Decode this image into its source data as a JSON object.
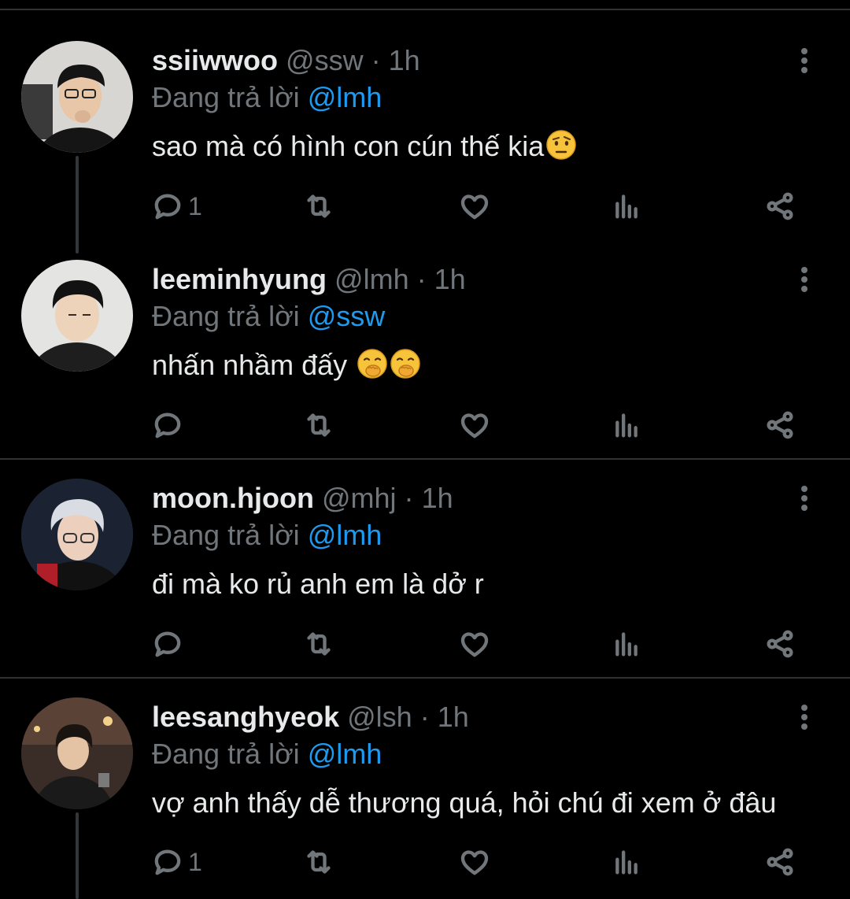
{
  "reply_prefix": "Đang trả lời",
  "icons": {
    "more": "more-vertical-icon",
    "reply": "reply-bubble-icon",
    "retweet": "retweet-icon",
    "like": "heart-icon",
    "views": "bar-chart-icon",
    "share": "share-icon"
  },
  "colors": {
    "background": "#000000",
    "text": "#e7e9ea",
    "muted": "#71767b",
    "mention": "#1d9bf0",
    "divider": "#2f3336"
  },
  "tweets": [
    {
      "name": "ssiiwwoo",
      "handle": "@ssw",
      "separator": "·",
      "time": "1h",
      "replying_to": "@lmh",
      "text": "sao mà có hình con cún thế kia",
      "emojis": [
        "face-with-raised-eyebrow"
      ],
      "reply_count": "1"
    },
    {
      "name": "leeminhyung",
      "handle": "@lmh",
      "separator": "·",
      "time": "1h",
      "replying_to": "@ssw",
      "text": "nhấn nhầm đấy ",
      "emojis": [
        "face-with-hand-over-mouth",
        "face-with-hand-over-mouth"
      ],
      "reply_count": ""
    },
    {
      "name": "moon.hjoon",
      "handle": "@mhj",
      "separator": "·",
      "time": "1h",
      "replying_to": "@lmh",
      "text": "đi mà ko rủ anh em là dở r",
      "emojis": [],
      "reply_count": ""
    },
    {
      "name": "leesanghyeok",
      "handle": "@lsh",
      "separator": "·",
      "time": "1h",
      "replying_to": "@lmh",
      "text": "vợ anh thấy dễ thương quá, hỏi chú đi xem ở đâu",
      "emojis": [],
      "reply_count": "1"
    }
  ]
}
